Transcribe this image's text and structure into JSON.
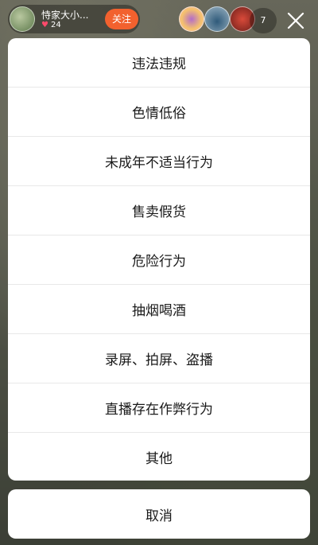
{
  "header": {
    "host_name": "恃家大小...",
    "likes": "24",
    "follow_label": "关注",
    "viewer_count": "7",
    "icons": {
      "likes": "heart-icon",
      "close": "close-icon"
    }
  },
  "report_sheet": {
    "options": [
      {
        "label": "违法违规"
      },
      {
        "label": "色情低俗"
      },
      {
        "label": "未成年不适当行为"
      },
      {
        "label": "售卖假货"
      },
      {
        "label": "危险行为"
      },
      {
        "label": "抽烟喝酒"
      },
      {
        "label": "录屏、拍屏、盗播"
      },
      {
        "label": "直播存在作弊行为"
      },
      {
        "label": "其他"
      }
    ],
    "cancel_label": "取消"
  },
  "colors": {
    "follow_button": "#f2612e",
    "sheet_background": "#ffffff",
    "divider": "#e8e8e8",
    "heart": "#ff4a6b"
  }
}
